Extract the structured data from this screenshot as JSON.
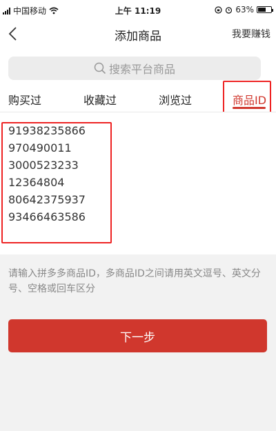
{
  "status_bar": {
    "carrier": "中国移动",
    "time": "上午 11:19",
    "battery": "63%",
    "battery_level": 0.63
  },
  "navbar": {
    "back_icon": "chevron-left-icon",
    "title": "添加商品",
    "right_link": "我要赚钱"
  },
  "search": {
    "placeholder": "搜索平台商品",
    "icon": "search-icon"
  },
  "tabs": [
    {
      "label": "购买过",
      "active": false
    },
    {
      "label": "收藏过",
      "active": false
    },
    {
      "label": "浏览过",
      "active": false
    },
    {
      "label": "商品ID",
      "active": true
    }
  ],
  "product_ids": [
    "91938235866",
    "970490011",
    "3000523233",
    "12364804",
    "80642375937",
    "93466463586"
  ],
  "hint": "请输入拼多多商品ID，多商品ID之间请用英文逗号、英文分号、空格或回车区分",
  "next_button": "下一步",
  "colors": {
    "accent": "#d0372d",
    "annotation_red": "#ee2222"
  }
}
